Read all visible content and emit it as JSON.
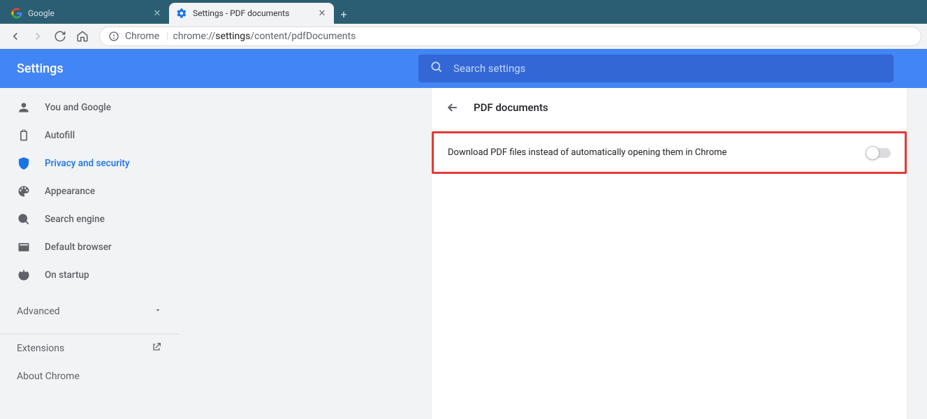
{
  "tabs": [
    {
      "title": "Google",
      "active": false
    },
    {
      "title": "Settings - PDF documents",
      "active": true
    }
  ],
  "omnibox": {
    "origin": "Chrome",
    "prefix": "chrome://",
    "bold": "settings",
    "rest": "/content/pdfDocuments"
  },
  "header": {
    "title": "Settings",
    "searchPlaceholder": "Search settings"
  },
  "sidebar": {
    "items": [
      {
        "label": "You and Google",
        "active": false
      },
      {
        "label": "Autofill",
        "active": false
      },
      {
        "label": "Privacy and security",
        "active": true
      },
      {
        "label": "Appearance",
        "active": false
      },
      {
        "label": "Search engine",
        "active": false
      },
      {
        "label": "Default browser",
        "active": false
      },
      {
        "label": "On startup",
        "active": false
      }
    ],
    "advanced": "Advanced",
    "extensions": "Extensions",
    "about": "About Chrome"
  },
  "main": {
    "title": "PDF documents",
    "settingText": "Download PDF files instead of automatically opening them in Chrome",
    "toggleOn": false
  }
}
